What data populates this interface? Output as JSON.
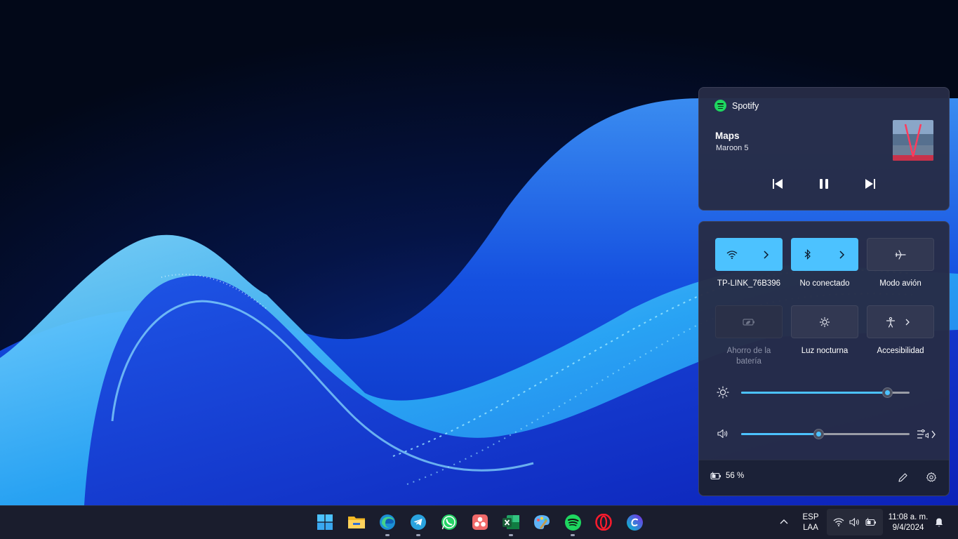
{
  "media": {
    "app_name": "Spotify",
    "track_title": "Maps",
    "artist": "Maroon 5",
    "controls": [
      "previous-track-icon",
      "pause-icon",
      "next-track-icon"
    ]
  },
  "quick_settings": {
    "tiles": [
      {
        "label": "TP-LINK_76B396",
        "icon": "wifi-icon",
        "state": "on",
        "expandable": true
      },
      {
        "label": "No conectado",
        "icon": "bluetooth-icon",
        "state": "on",
        "expandable": true
      },
      {
        "label": "Modo avión",
        "icon": "airplane-icon",
        "state": "off",
        "expandable": false
      },
      {
        "label_line1": "Ahorro de la",
        "label_line2": "batería",
        "icon": "battery-saver-icon",
        "state": "disabled",
        "expandable": false
      },
      {
        "label": "Luz nocturna",
        "icon": "night-light-icon",
        "state": "off",
        "expandable": false
      },
      {
        "label": "Accesibilidad",
        "icon": "accessibility-icon",
        "state": "off",
        "expandable": true
      }
    ],
    "brightness_level": 0.87,
    "volume_level": 0.46,
    "battery_text": "56 %"
  },
  "taskbar": {
    "apps": [
      "start-icon",
      "file-explorer-icon",
      "edge-icon",
      "telegram-icon",
      "whatsapp-icon",
      "asana-icon",
      "excel-icon",
      "paint-icon",
      "spotify-icon",
      "opera-icon",
      "canva-icon"
    ],
    "language_line1": "ESP",
    "language_line2": "LAA",
    "time": "11:08 a. m.",
    "date": "9/4/2024"
  },
  "colors": {
    "accent": "#4cc2ff",
    "panel": "#262c46",
    "taskbar": "#1a1d2d",
    "spotify_green": "#1ed760"
  }
}
